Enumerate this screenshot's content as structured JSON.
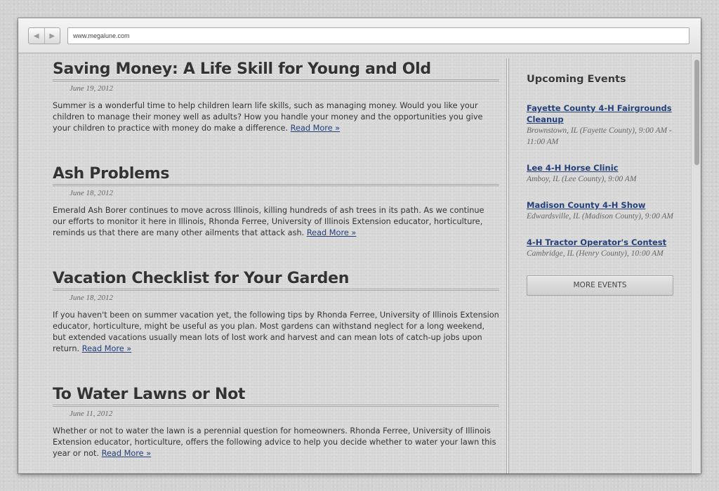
{
  "browser": {
    "url": "www.megalune.com",
    "back_glyph": "◀",
    "forward_glyph": "▶"
  },
  "posts": [
    {
      "title": "Saving Money: A Life Skill for Young and Old",
      "date": "June 19, 2012",
      "body": "Summer is a wonderful time to help children learn life skills, such as managing money. Would you like your children to manage their money well as adults? How you handle your money and the opportunities you give your children to practice with money do make a difference.",
      "read_more": "Read More »"
    },
    {
      "title": "Ash Problems",
      "date": "June 18, 2012",
      "body": "Emerald Ash Borer continues to move across Illinois, killing hundreds of ash trees in its path. As we continue our efforts to monitor it here in Illinois, Rhonda Ferree, University of Illinois Extension educator, horticulture, reminds us that there are many other ailments that attack ash.",
      "read_more": "Read More »"
    },
    {
      "title": "Vacation Checklist for Your Garden",
      "date": "June 18, 2012",
      "body": "If you haven't been on summer vacation yet, the following tips by Rhonda Ferree, University of Illinois Extension educator, horticulture, might be useful as you plan. Most gardens can withstand neglect for a long weekend, but extended vacations usually mean lots of lost work and harvest and can mean lots of catch-up jobs upon return.",
      "read_more": "Read More »"
    },
    {
      "title": "To Water Lawns or Not",
      "date": "June 11, 2012",
      "body": "Whether or not to water the lawn is a perennial question for homeowners. Rhonda Ferree, University of Illinois Extension educator, horticulture, offers the following advice to help you decide whether to water your lawn this year or not.",
      "read_more": "Read More »"
    }
  ],
  "sidebar": {
    "title": "Upcoming Events",
    "events": [
      {
        "name": "Fayette County 4-H Fairgrounds Cleanup",
        "info": "Brownstown, IL (Fayette County), 9:00 AM - 11:00 AM"
      },
      {
        "name": "Lee 4-H Horse Clinic",
        "info": "Amboy, IL (Lee County), 9:00 AM"
      },
      {
        "name": "Madison County 4-H Show",
        "info": "Edwardsville, IL (Madison County), 9:00 AM"
      },
      {
        "name": "4-H Tractor Operator's Contest",
        "info": "Cambridge, IL (Henry County), 10:00 AM"
      }
    ],
    "more_button": "MORE EVENTS"
  },
  "colors": {
    "link": "#24407a",
    "heading": "#333333",
    "background": "#d7d7d7"
  }
}
